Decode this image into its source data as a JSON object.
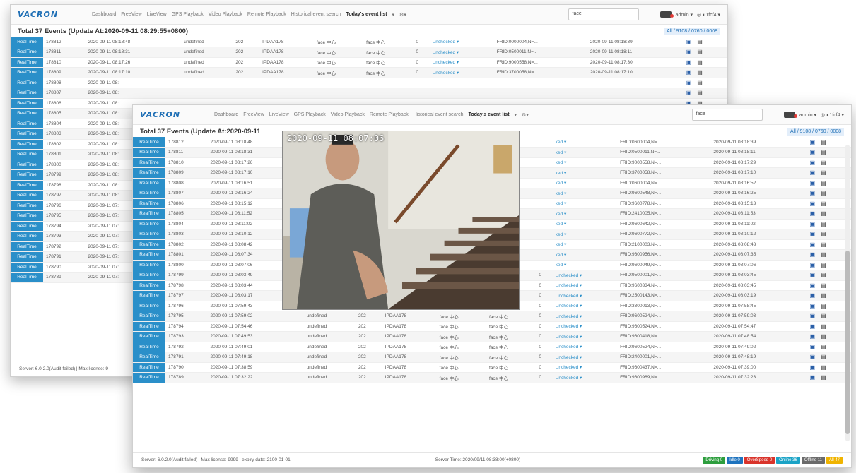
{
  "app": {
    "logo": "VACRON",
    "nav": [
      "Dashboard",
      "FreeView",
      "LiveView",
      "GPS Playback",
      "Video Playback",
      "Remote Playback",
      "Historical event search",
      "Today's event list",
      "▾",
      "⚙▾"
    ],
    "search_value": "face",
    "user": "admin ▾",
    "user_info": "◎ ◐1fcf4 ▾"
  },
  "back_window": {
    "title": "Total 37 Events (Update At:2020-09-11 08:29:55+0800)",
    "filter": "All / 9108 / 0760 / 0008",
    "footer": "Server: 6.0.2.0(Audit failed) | Max license: 9",
    "rows": [
      {
        "rt": "RealTime",
        "id": "178812",
        "time": "2020-09-11 08:18:48",
        "type": "undefined",
        "ch": "202",
        "dev": "IPDAA178",
        "c1": "face 中心",
        "c2": "face 中心",
        "n": "0",
        "status": "Unchecked ▾",
        "frid": "FRID:0000004,N=...",
        "t2": "2020-09-11 08:18:39"
      },
      {
        "rt": "RealTime",
        "id": "178811",
        "time": "2020-09-11 08:18:31",
        "type": "undefined",
        "ch": "202",
        "dev": "IPDAA178",
        "c1": "face 中心",
        "c2": "face 中心",
        "n": "0",
        "status": "Unchecked ▾",
        "frid": "FRID:0500011,N=...",
        "t2": "2020-09-11 08:18:11"
      },
      {
        "rt": "RealTime",
        "id": "178810",
        "time": "2020-09-11 08:17:26",
        "type": "undefined",
        "ch": "202",
        "dev": "IPDAA178",
        "c1": "face 中心",
        "c2": "face 中心",
        "n": "0",
        "status": "Unchecked ▾",
        "frid": "FRID:9000558,N=...",
        "t2": "2020-09-11 08:17:30"
      },
      {
        "rt": "RealTime",
        "id": "178809",
        "time": "2020-09-11 08:17:10",
        "type": "undefined",
        "ch": "202",
        "dev": "IPDAA178",
        "c1": "face 中心",
        "c2": "face 中心",
        "n": "0",
        "status": "Unchecked ▾",
        "frid": "FRID:3700058,N=...",
        "t2": "2020-09-11 08:17:10"
      },
      {
        "rt": "RealTime",
        "id": "178808",
        "time": "2020-09-11 08:",
        "type": "",
        "ch": "",
        "dev": "",
        "c1": "",
        "c2": "",
        "n": "",
        "status": "",
        "frid": "",
        "t2": ""
      },
      {
        "rt": "RealTime",
        "id": "178807",
        "time": "2020-09-11 08:",
        "type": "",
        "ch": "",
        "dev": "",
        "c1": "",
        "c2": "",
        "n": "",
        "status": "",
        "frid": "",
        "t2": ""
      },
      {
        "rt": "RealTime",
        "id": "178806",
        "time": "2020-09-11 08:",
        "type": "",
        "ch": "",
        "dev": "",
        "c1": "",
        "c2": "",
        "n": "",
        "status": "",
        "frid": "",
        "t2": ""
      },
      {
        "rt": "RealTime",
        "id": "178805",
        "time": "2020-09-11 08:",
        "type": "",
        "ch": "",
        "dev": "",
        "c1": "",
        "c2": "",
        "n": "",
        "status": "",
        "frid": "",
        "t2": ""
      },
      {
        "rt": "RealTime",
        "id": "178804",
        "time": "2020-09-11 08:",
        "type": "",
        "ch": "",
        "dev": "",
        "c1": "",
        "c2": "",
        "n": "",
        "status": "",
        "frid": "",
        "t2": ""
      },
      {
        "rt": "RealTime",
        "id": "178803",
        "time": "2020-09-11 08:",
        "type": "",
        "ch": "",
        "dev": "",
        "c1": "",
        "c2": "",
        "n": "",
        "status": "",
        "frid": "",
        "t2": ""
      },
      {
        "rt": "RealTime",
        "id": "178802",
        "time": "2020-09-11 08:",
        "type": "",
        "ch": "",
        "dev": "",
        "c1": "",
        "c2": "",
        "n": "",
        "status": "",
        "frid": "",
        "t2": ""
      },
      {
        "rt": "RealTime",
        "id": "178801",
        "time": "2020-09-11 08:",
        "type": "",
        "ch": "",
        "dev": "",
        "c1": "",
        "c2": "",
        "n": "",
        "status": "",
        "frid": "",
        "t2": ""
      },
      {
        "rt": "RealTime",
        "id": "178800",
        "time": "2020-09-11 08:",
        "type": "",
        "ch": "",
        "dev": "",
        "c1": "",
        "c2": "",
        "n": "",
        "status": "",
        "frid": "",
        "t2": ""
      },
      {
        "rt": "RealTime",
        "id": "178799",
        "time": "2020-09-11 08:",
        "type": "",
        "ch": "",
        "dev": "",
        "c1": "",
        "c2": "",
        "n": "",
        "status": "",
        "frid": "",
        "t2": ""
      },
      {
        "rt": "RealTime",
        "id": "178798",
        "time": "2020-09-11 08:",
        "type": "",
        "ch": "",
        "dev": "",
        "c1": "",
        "c2": "",
        "n": "",
        "status": "",
        "frid": "",
        "t2": ""
      },
      {
        "rt": "RealTime",
        "id": "178797",
        "time": "2020-09-11 08:",
        "type": "",
        "ch": "",
        "dev": "",
        "c1": "",
        "c2": "",
        "n": "",
        "status": "",
        "frid": "",
        "t2": ""
      },
      {
        "rt": "RealTime",
        "id": "178796",
        "time": "2020-09-11 07:",
        "type": "",
        "ch": "",
        "dev": "",
        "c1": "",
        "c2": "",
        "n": "",
        "status": "",
        "frid": "",
        "t2": ""
      },
      {
        "rt": "RealTime",
        "id": "178795",
        "time": "2020-09-11 07:",
        "type": "",
        "ch": "",
        "dev": "",
        "c1": "",
        "c2": "",
        "n": "",
        "status": "",
        "frid": "",
        "t2": ""
      },
      {
        "rt": "RealTime",
        "id": "178794",
        "time": "2020-09-11 07:",
        "type": "",
        "ch": "",
        "dev": "",
        "c1": "",
        "c2": "",
        "n": "",
        "status": "",
        "frid": "",
        "t2": ""
      },
      {
        "rt": "RealTime",
        "id": "178793",
        "time": "2020-09-11 07:",
        "type": "",
        "ch": "",
        "dev": "",
        "c1": "",
        "c2": "",
        "n": "",
        "status": "",
        "frid": "",
        "t2": ""
      },
      {
        "rt": "RealTime",
        "id": "178792",
        "time": "2020-09-11 07:",
        "type": "",
        "ch": "",
        "dev": "",
        "c1": "",
        "c2": "",
        "n": "",
        "status": "",
        "frid": "",
        "t2": ""
      },
      {
        "rt": "RealTime",
        "id": "178791",
        "time": "2020-09-11 07:",
        "type": "",
        "ch": "",
        "dev": "",
        "c1": "",
        "c2": "",
        "n": "",
        "status": "",
        "frid": "",
        "t2": ""
      },
      {
        "rt": "RealTime",
        "id": "178790",
        "time": "2020-09-11 07:",
        "type": "",
        "ch": "",
        "dev": "",
        "c1": "",
        "c2": "",
        "n": "",
        "status": "",
        "frid": "",
        "t2": ""
      },
      {
        "rt": "RealTime",
        "id": "178789",
        "time": "2020-09-11 07:",
        "type": "",
        "ch": "",
        "dev": "",
        "c1": "",
        "c2": "",
        "n": "",
        "status": "",
        "frid": "",
        "t2": ""
      }
    ]
  },
  "front_window": {
    "title": "Total 37 Events (Update At:2020-09-11",
    "filter": "All / 9108 / 0760 / 0008",
    "snapshot_timestamp": "2020-09-11 08:07:06",
    "footer_left": "Server: 6.0.2.0(Audit failed) | Max license: 9999 | expiry date: 2100-01-01",
    "footer_time": "Server Time: 2020/09/11 08:38:00(+0800)",
    "badges": [
      {
        "label": "Driving 0",
        "color": "#2e9e3e"
      },
      {
        "label": "Idle 0",
        "color": "#1e73be"
      },
      {
        "label": "OverSpeed 0",
        "color": "#d9342b"
      },
      {
        "label": "Online 36",
        "color": "#1ba3c6"
      },
      {
        "label": "Offline 11",
        "color": "#6b6b6b"
      },
      {
        "label": "All 47",
        "color": "#f0b400"
      }
    ],
    "rows": [
      {
        "rt": "RealTime",
        "id": "178812",
        "time": "2020-09-11 08:18:48",
        "type": "",
        "ch": "",
        "dev": "",
        "c1": "",
        "c2": "",
        "n": "",
        "status": "ked ▾",
        "frid": "FRID:0600004,N=...",
        "t2": "2020-09-11 08:18:39"
      },
      {
        "rt": "RealTime",
        "id": "178811",
        "time": "2020-09-11 08:18:31",
        "type": "",
        "ch": "",
        "dev": "",
        "c1": "",
        "c2": "",
        "n": "",
        "status": "ked ▾",
        "frid": "FRID:0500011,N=...",
        "t2": "2020-09-11 08:18:11"
      },
      {
        "rt": "RealTime",
        "id": "178810",
        "time": "2020-09-11 08:17:26",
        "type": "",
        "ch": "",
        "dev": "",
        "c1": "",
        "c2": "",
        "n": "",
        "status": "ked ▾",
        "frid": "FRID:9000558,N=...",
        "t2": "2020-09-11 08:17:29"
      },
      {
        "rt": "RealTime",
        "id": "178809",
        "time": "2020-09-11 08:17:10",
        "type": "",
        "ch": "",
        "dev": "",
        "c1": "",
        "c2": "",
        "n": "",
        "status": "ked ▾",
        "frid": "FRID:3700058,N=...",
        "t2": "2020-09-11 08:17:10"
      },
      {
        "rt": "RealTime",
        "id": "178808",
        "time": "2020-09-11 08:16:51",
        "type": "",
        "ch": "",
        "dev": "",
        "c1": "",
        "c2": "",
        "n": "",
        "status": "ked ▾",
        "frid": "FRID:0600004,N=...",
        "t2": "2020-09-11 08:16:52"
      },
      {
        "rt": "RealTime",
        "id": "178807",
        "time": "2020-09-11 08:16:24",
        "type": "",
        "ch": "",
        "dev": "",
        "c1": "",
        "c2": "",
        "n": "",
        "status": "ked ▾",
        "frid": "FRID:9600548,N=...",
        "t2": "2020-09-11 08:16:25"
      },
      {
        "rt": "RealTime",
        "id": "178806",
        "time": "2020-09-11 08:15:12",
        "type": "",
        "ch": "",
        "dev": "",
        "c1": "",
        "c2": "",
        "n": "",
        "status": "ked ▾",
        "frid": "FRID:9600778,N=...",
        "t2": "2020-09-11 08:15:13"
      },
      {
        "rt": "RealTime",
        "id": "178805",
        "time": "2020-09-11 08:11:52",
        "type": "",
        "ch": "",
        "dev": "",
        "c1": "",
        "c2": "",
        "n": "",
        "status": "ked ▾",
        "frid": "FRID:2410005,N=...",
        "t2": "2020-09-11 08:11:53"
      },
      {
        "rt": "RealTime",
        "id": "178804",
        "time": "2020-09-11 08:11:02",
        "type": "",
        "ch": "",
        "dev": "",
        "c1": "",
        "c2": "",
        "n": "",
        "status": "ked ▾",
        "frid": "FRID:9600642,N=...",
        "t2": "2020-09-11 08:11:02"
      },
      {
        "rt": "RealTime",
        "id": "178803",
        "time": "2020-09-11 08:10:12",
        "type": "",
        "ch": "",
        "dev": "",
        "c1": "",
        "c2": "",
        "n": "",
        "status": "ked ▾",
        "frid": "FRID:9600772,N=...",
        "t2": "2020-09-11 08:10:12"
      },
      {
        "rt": "RealTime",
        "id": "178802",
        "time": "2020-09-11 08:08:42",
        "type": "",
        "ch": "",
        "dev": "",
        "c1": "",
        "c2": "",
        "n": "",
        "status": "ked ▾",
        "frid": "FRID:2100003,N=...",
        "t2": "2020-09-11 08:08:43"
      },
      {
        "rt": "RealTime",
        "id": "178801",
        "time": "2020-09-11 08:07:34",
        "type": "",
        "ch": "",
        "dev": "",
        "c1": "",
        "c2": "",
        "n": "",
        "status": "ked ▾",
        "frid": "FRID:9600956,N=...",
        "t2": "2020-09-11 08:07:35"
      },
      {
        "rt": "RealTime",
        "id": "178800",
        "time": "2020-09-11 08:07:06",
        "type": "",
        "ch": "",
        "dev": "",
        "c1": "",
        "c2": "",
        "n": "",
        "status": "ked ▾",
        "frid": "FRID:9600049,N=...",
        "t2": "2020-09-11 08:07:06"
      },
      {
        "rt": "RealTime",
        "id": "178799",
        "time": "2020-09-11 08:03:49",
        "type": "undefined",
        "ch": "202",
        "dev": "IPDAA178",
        "c1": "face 中心",
        "c2": "face 中心",
        "n": "0",
        "status": "Unchecked ▾",
        "frid": "FRID:9500001,N=...",
        "t2": "2020-09-11 08:03:45"
      },
      {
        "rt": "RealTime",
        "id": "178798",
        "time": "2020-09-11 08:03:44",
        "type": "undefined",
        "ch": "202",
        "dev": "IPDAA178",
        "c1": "face 中心",
        "c2": "face 中心",
        "n": "0",
        "status": "Unchecked ▾",
        "frid": "FRID:9600334,N=...",
        "t2": "2020-09-11 08:03:45"
      },
      {
        "rt": "RealTime",
        "id": "178797",
        "time": "2020-09-11 08:03:17",
        "type": "undefined",
        "ch": "202",
        "dev": "IPDAA178",
        "c1": "face 中心",
        "c2": "face 中心",
        "n": "0",
        "status": "Unchecked ▾",
        "frid": "FRID:2500143,N=...",
        "t2": "2020-09-11 08:03:19"
      },
      {
        "rt": "RealTime",
        "id": "178796",
        "time": "2020-09-11 07:59:43",
        "type": "undefined",
        "ch": "202",
        "dev": "IPDAA178",
        "c1": "face 中心",
        "c2": "face 中心",
        "n": "0",
        "status": "Unchecked ▾",
        "frid": "FRID:3300013,N=...",
        "t2": "2020-09-11 07:58:45"
      },
      {
        "rt": "RealTime",
        "id": "178795",
        "time": "2020-09-11 07:59:02",
        "type": "undefined",
        "ch": "202",
        "dev": "IPDAA178",
        "c1": "face 中心",
        "c2": "face 中心",
        "n": "0",
        "status": "Unchecked ▾",
        "frid": "FRID:9600524,N=...",
        "t2": "2020-09-11 07:59:03"
      },
      {
        "rt": "RealTime",
        "id": "178794",
        "time": "2020-09-11 07:54:46",
        "type": "undefined",
        "ch": "202",
        "dev": "IPDAA178",
        "c1": "face 中心",
        "c2": "face 中心",
        "n": "0",
        "status": "Unchecked ▾",
        "frid": "FRID:9600524,N=...",
        "t2": "2020-09-11 07:54:47"
      },
      {
        "rt": "RealTime",
        "id": "178793",
        "time": "2020-09-11 07:49:53",
        "type": "undefined",
        "ch": "202",
        "dev": "IPDAA178",
        "c1": "face 中心",
        "c2": "face 中心",
        "n": "0",
        "status": "Unchecked ▾",
        "frid": "FRID:9600418,N=...",
        "t2": "2020-09-11 07:48:54"
      },
      {
        "rt": "RealTime",
        "id": "178792",
        "time": "2020-09-11 07:49:01",
        "type": "undefined",
        "ch": "202",
        "dev": "IPDAA178",
        "c1": "face 中心",
        "c2": "face 中心",
        "n": "0",
        "status": "Unchecked ▾",
        "frid": "FRID:9600524,N=...",
        "t2": "2020-09-11 07:49:02"
      },
      {
        "rt": "RealTime",
        "id": "178791",
        "time": "2020-09-11 07:49:18",
        "type": "undefined",
        "ch": "202",
        "dev": "IPDAA178",
        "c1": "face 中心",
        "c2": "face 中心",
        "n": "0",
        "status": "Unchecked ▾",
        "frid": "FRID:2400001,N=...",
        "t2": "2020-09-11 07:48:19"
      },
      {
        "rt": "RealTime",
        "id": "178790",
        "time": "2020-09-11 07:38:59",
        "type": "undefined",
        "ch": "202",
        "dev": "IPDAA178",
        "c1": "face 中心",
        "c2": "face 中心",
        "n": "0",
        "status": "Unchecked ▾",
        "frid": "FRID:9600437,N=...",
        "t2": "2020-09-11 07:39:00"
      },
      {
        "rt": "RealTime",
        "id": "178789",
        "time": "2020-09-11 07:32:22",
        "type": "undefined",
        "ch": "202",
        "dev": "IPDAA178",
        "c1": "face 中心",
        "c2": "face 中心",
        "n": "0",
        "status": "Unchecked ▾",
        "frid": "FRID:9600989,N=...",
        "t2": "2020-09-11 07:32:23"
      }
    ]
  }
}
